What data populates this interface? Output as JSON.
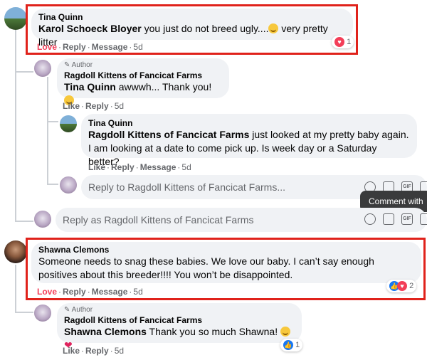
{
  "comments": {
    "c1": {
      "author": "Tina Quinn",
      "mention": "Karol Schoeck Bloyer",
      "text": " you just do not breed ugly....",
      "text_tail": " very pretty litter",
      "action_love": "Love",
      "action_reply": "Reply",
      "action_message": "Message",
      "time": "5d",
      "reaction_count": "1"
    },
    "r1": {
      "author_tag": "Author",
      "author": "Ragdoll Kittens of Fancicat Farms",
      "mention": "Tina Quinn",
      "text": " awwwh... Thank you! ",
      "action_like": "Like",
      "action_reply": "Reply",
      "time": "5d"
    },
    "r2": {
      "author": "Tina Quinn",
      "mention": "Ragdoll Kittens of Fancicat Farms",
      "text": " just looked at my pretty baby again. I am looking at a date to come pick up. Is week day or a Saturday better?",
      "action_like": "Like",
      "action_reply": "Reply",
      "action_message": "Message",
      "time": "5d"
    },
    "c2": {
      "author": "Shawna Clemons",
      "text": "Someone needs to snag these babies. We love our baby. I can’t say enough positives about this breeder!!!! You won’t be disappointed.",
      "action_love": "Love",
      "action_reply": "Reply",
      "action_message": "Message",
      "time": "5d",
      "reaction_count": "2"
    },
    "r3": {
      "author_tag": "Author",
      "author": "Ragdoll Kittens of Fancicat Farms",
      "mention": "Shawna Clemons",
      "text": " Thank you so much Shawna! ",
      "action_like": "Like",
      "action_reply": "Reply",
      "time": "5d",
      "reaction_count": "1"
    }
  },
  "reply_inputs": {
    "nested_placeholder": "Reply to Ragdoll Kittens of Fancicat Farms...",
    "page_placeholder": "Reply as Ragdoll Kittens of Fancicat Farms"
  },
  "tooltip": "Comment with",
  "colors": {
    "highlight": "#e0221b",
    "bubble": "#f0f2f5",
    "meta": "#65676b",
    "love": "#f33e58",
    "like": "#1877f2"
  }
}
